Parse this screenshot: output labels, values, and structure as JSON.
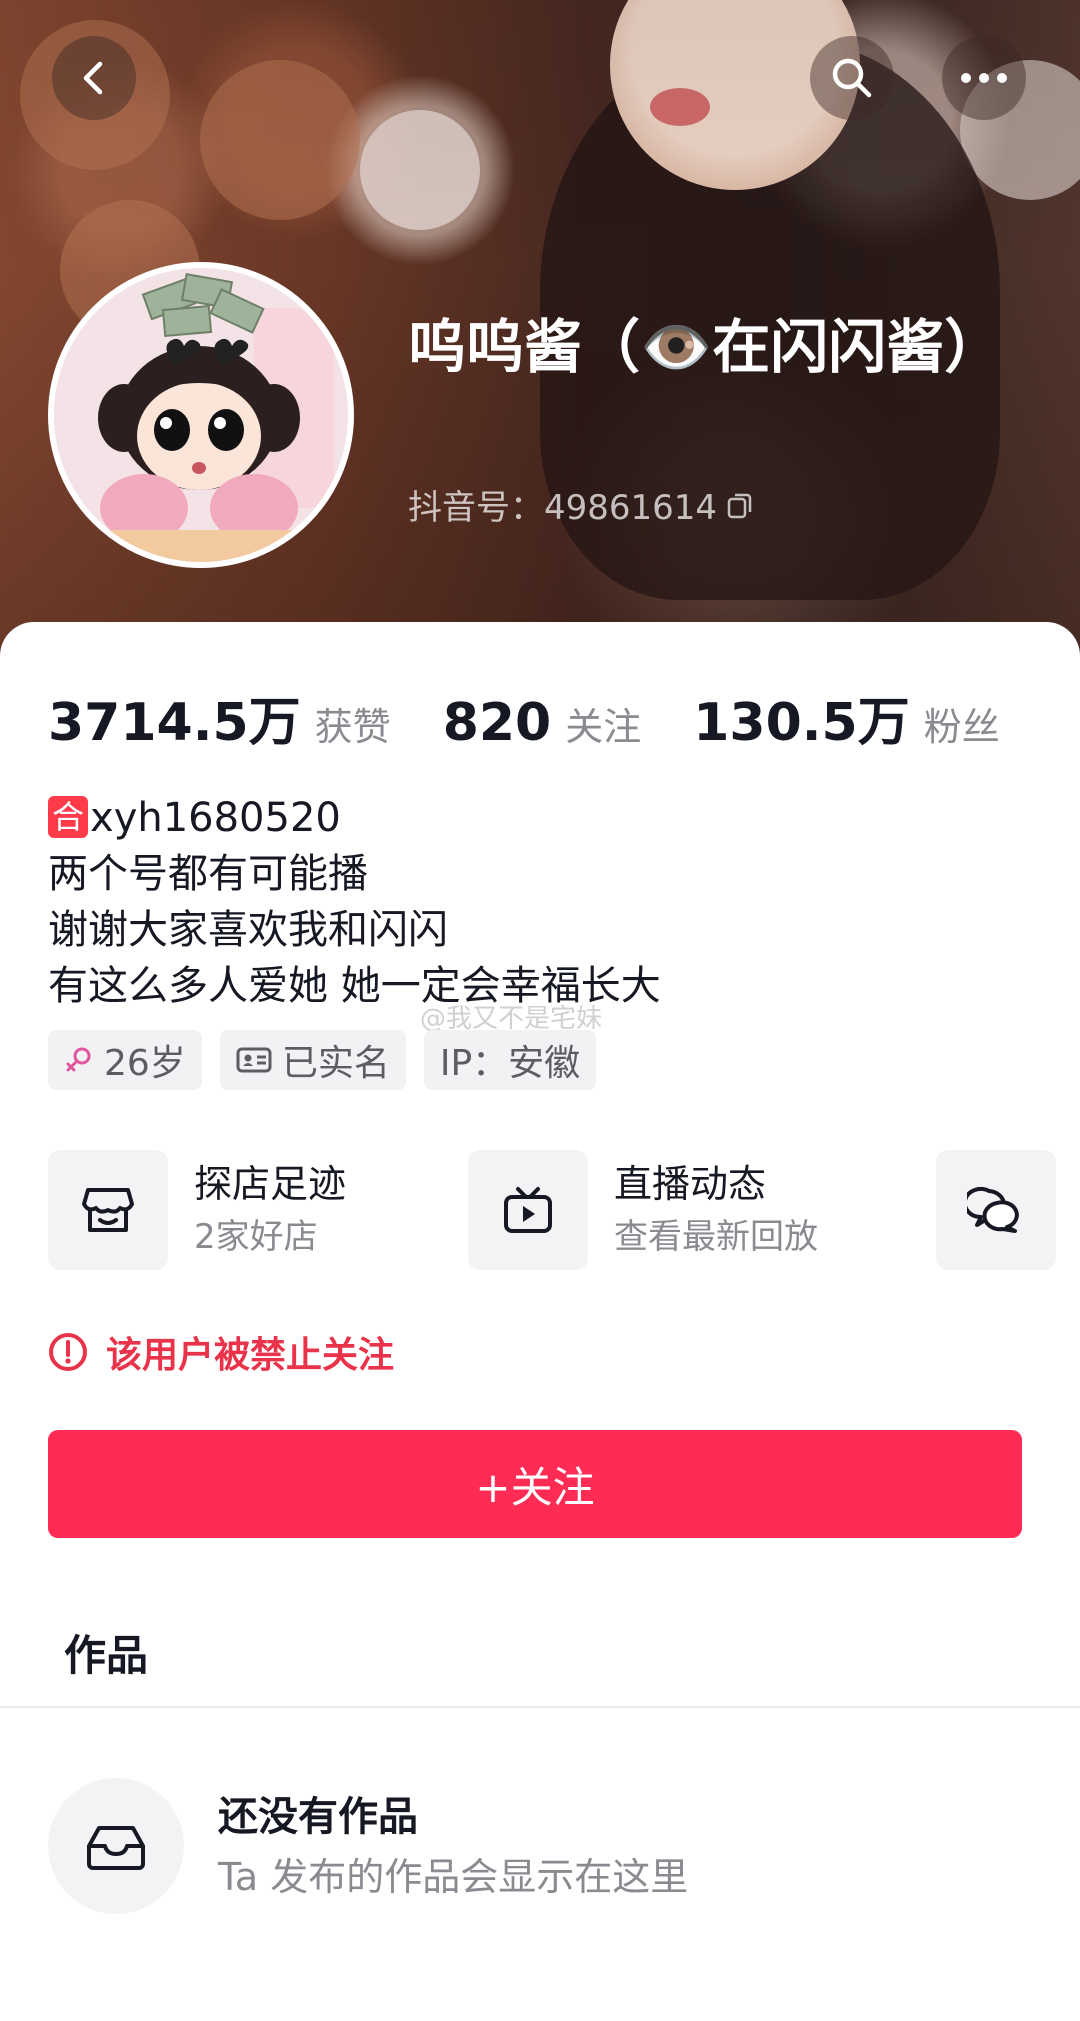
{
  "header": {
    "nickname": "呜呜酱（👁️在闪闪酱）",
    "douyin_id": "抖音号：49861614"
  },
  "stats": [
    {
      "value": "3714.5万",
      "label": "获赞"
    },
    {
      "value": "820",
      "label": "关注"
    },
    {
      "value": "130.5万",
      "label": "粉丝"
    }
  ],
  "bio": {
    "badge": "合",
    "line1_rest": "xyh1680520",
    "line2": "两个号都有可能播",
    "line3": "谢谢大家喜欢我和闪闪",
    "line4": "有这么多人爱她 她一定会幸福长大"
  },
  "watermark": "@我又不是宅妹",
  "tags": {
    "age": "26岁",
    "verified": "已实名",
    "ip": "IP：安徽"
  },
  "services": {
    "shop_title": "探店足迹",
    "shop_sub": "2家好店",
    "live_title": "直播动态",
    "live_sub": "查看最新回放"
  },
  "warning": "该用户被禁止关注",
  "follow_button": "+关注",
  "works_tab": "作品",
  "empty_state": {
    "title": "还没有作品",
    "subtitle": "Ta 发布的作品会显示在这里"
  },
  "colors": {
    "accent": "#fe2c55",
    "warning": "#e8334a",
    "badge": "#ff3b4a",
    "female": "#e0569d"
  },
  "icons": [
    "back-arrow-icon",
    "search-icon",
    "more-icon",
    "copy-icon",
    "female-icon",
    "id-card-icon",
    "store-icon",
    "tv-icon",
    "chat-icon",
    "alert-circle-icon",
    "inbox-icon"
  ]
}
